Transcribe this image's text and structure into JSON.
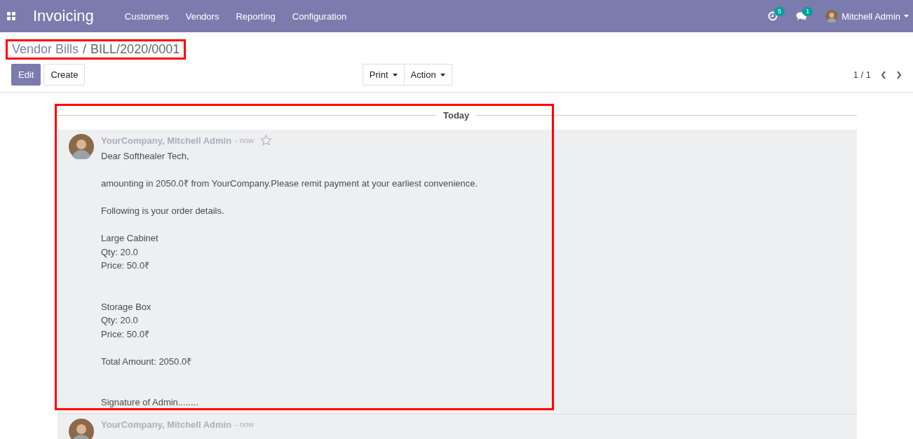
{
  "navbar": {
    "app_title": "Invoicing",
    "menu": [
      "Customers",
      "Vendors",
      "Reporting",
      "Configuration"
    ],
    "activity_badge": "5",
    "messages_badge": "1",
    "user": "Mitchell Admin"
  },
  "breadcrumb": {
    "parent": "Vendor Bills",
    "divider": "/",
    "current": "BILL/2020/0001"
  },
  "buttons": [
    {
      "label": "Edit",
      "kind": "primary"
    },
    {
      "label": "Create",
      "kind": "secondary"
    }
  ],
  "dropdowns": [
    "Print",
    "Action"
  ],
  "pager": "1 / 1",
  "separator": "Today",
  "messages": [
    {
      "author": "YourCompany, Mitchell Admin",
      "time": "- now",
      "starred": false,
      "paragraphs": [
        {
          "kind": "normal",
          "lines": [
            "Dear Softhealer Tech,"
          ]
        },
        {
          "kind": "normal",
          "lines": [
            "amounting in 2050.0₹ from YourCompany.Please remit payment at your earliest convenience."
          ]
        },
        {
          "kind": "normal",
          "lines": [
            "Following is your order details."
          ]
        },
        {
          "kind": "normal",
          "lines": [
            "Large Cabinet",
            "Qty: 20.0",
            "Price: 50.0₹"
          ]
        },
        {
          "kind": "wide",
          "lines": [
            "Storage Box",
            "Qty: 20.0",
            "Price: 50.0₹"
          ]
        },
        {
          "kind": "normal",
          "lines": [
            "Total Amount: 2050.0₹"
          ]
        },
        {
          "kind": "wide",
          "lines": [
            "Signature of Admin........"
          ]
        }
      ]
    },
    {
      "author": "YourCompany, Mitchell Admin",
      "time": "- now"
    }
  ]
}
